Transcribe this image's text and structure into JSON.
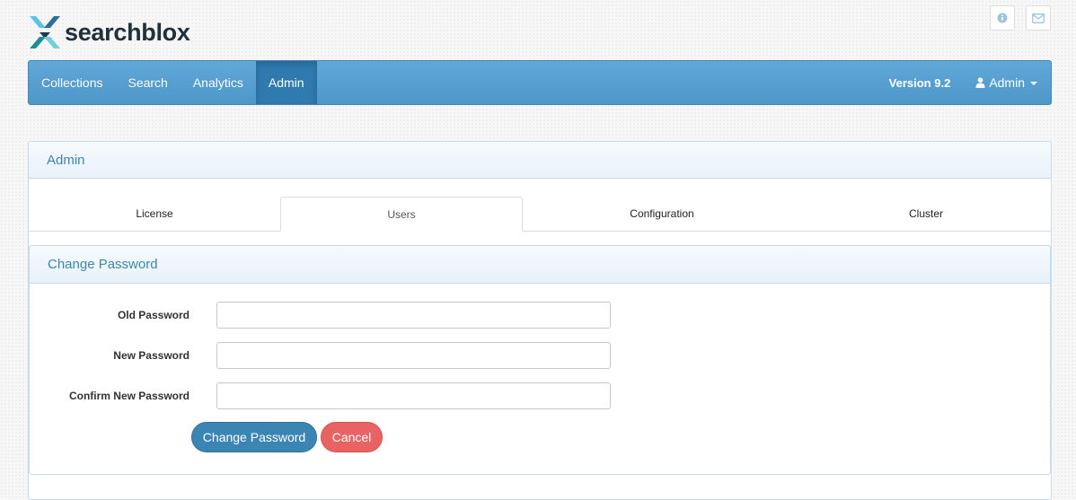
{
  "header": {
    "logo_text": "searchblox",
    "icons": [
      "info-icon",
      "envelope-icon"
    ]
  },
  "nav": {
    "items": [
      {
        "label": "Collections",
        "active": false
      },
      {
        "label": "Search",
        "active": false
      },
      {
        "label": "Analytics",
        "active": false
      },
      {
        "label": "Admin",
        "active": true
      }
    ],
    "version": "Version 9.2",
    "user_label": "Admin",
    "user_icon": "user-icon"
  },
  "admin_panel": {
    "title": "Admin",
    "tabs": [
      {
        "label": "License",
        "active": false
      },
      {
        "label": "Users",
        "active": true
      },
      {
        "label": "Configuration",
        "active": false
      },
      {
        "label": "Cluster",
        "active": false
      }
    ]
  },
  "change_password": {
    "title": "Change Password",
    "fields": {
      "old": {
        "label": "Old Password",
        "value": ""
      },
      "new": {
        "label": "New Password",
        "value": ""
      },
      "confirm": {
        "label": "Confirm New Password",
        "value": ""
      }
    },
    "submit_label": "Change Password",
    "cancel_label": "Cancel"
  },
  "colors": {
    "navbar": "#4d97c9",
    "nav_active": "#2f7bb0",
    "panel_title": "#3a87ad",
    "primary_button": "#3b85b5",
    "cancel_button": "#e86464"
  }
}
